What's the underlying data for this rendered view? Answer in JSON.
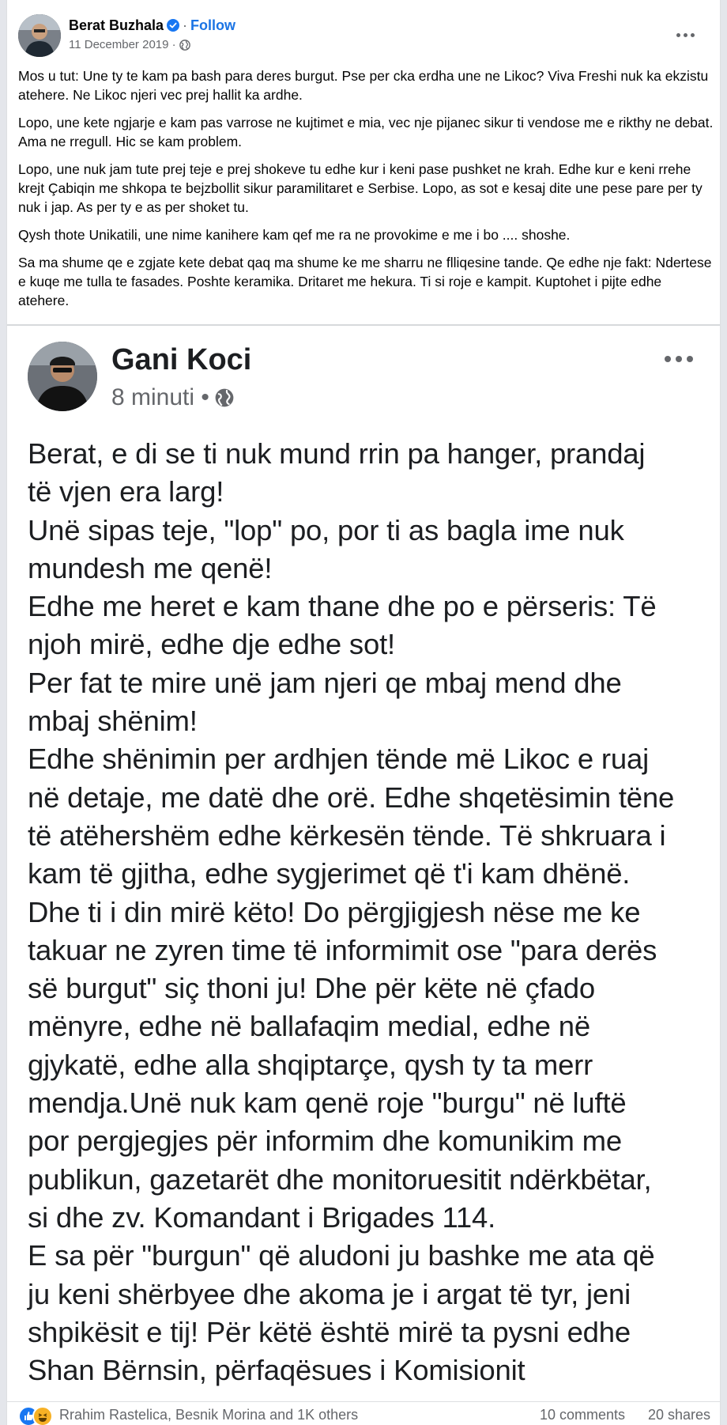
{
  "post": {
    "author": "Berat Buzhala",
    "separator": "·",
    "follow_label": "Follow",
    "date": "11 December 2019 ·",
    "paragraphs": [
      "Mos u tut: Une ty te kam pa bash para deres burgut. Pse per cka erdha une ne Likoc? Viva Freshi nuk ka ekzistu atehere. Ne Likoc njeri vec prej hallit ka ardhe.",
      "Lopo, une kete ngjarje e kam pas varrose ne kujtimet e mia, vec nje pijanec sikur ti vendose me e rikthy ne debat. Ama ne rregull. Hic se kam problem.",
      "Lopo, une nuk jam tute prej teje e prej shokeve tu edhe kur i keni pase pushket ne krah. Edhe kur e keni rrehe krejt Çabiqin me shkopa te bejzbollit sikur paramilitaret e Serbise. Lopo, as sot e kesaj dite une pese pare per ty nuk i jap. As per ty e as per shoket tu.",
      "Qysh thote Unikatili, une nime kanihere kam qef me ra ne provokime e me i bo .... shoshe.",
      "Sa ma shume qe e zgjate kete debat qaq ma shume ke me sharru ne flliqesine tande. Qe edhe nje fakt: Ndertese e kuqe me tulla te fasades. Poshte keramika. Dritaret me hekura. Ti si roje e kampit. Kuptohet i pijte edhe atehere."
    ]
  },
  "shared": {
    "author": "Gani Koci",
    "time": "8 minuti •",
    "body": "Berat, e di se ti nuk mund rrin pa hanger, prandaj\ntë vjen era larg!\nUnë sipas teje, \"lop\" po, por ti as bagla ime nuk\nmundesh me qenë!\nEdhe me heret e kam thane dhe po e përseris: Të\nnjoh mirë, edhe dje edhe sot!\nPer fat te mire unë jam njeri qe mbaj mend dhe\nmbaj shënim!\nEdhe shënimin per ardhjen tënde më Likoc e ruaj\nnë detaje, me datë dhe orë. Edhe shqetësimin tëne\ntë atëhershëm edhe kërkesën tënde. Të shkruara i\nkam të gjitha, edhe sygjerimet që t'i kam dhënë.\nDhe ti i din mirë këto! Do përgjigjesh nëse me ke\ntakuar ne zyren time të informimit ose \"para derës\nsë burgut\" siç thoni ju! Dhe për këte në çfado\nmënyre, edhe në ballafaqim medial, edhe në\ngjykatë, edhe alla shqiptarçe, qysh ty ta merr\nmendja.Unë nuk kam qenë roje \"burgu\" në luftë\npor pergjegjes për informim dhe komunikim me\npublikun, gazetarët dhe monitoruesitit ndërkbëtar,\nsi dhe zv. Komandant i Brigades 114.\nE sa për \"burgun\" që aludoni ju bashke me ata që\nju keni shërbyee dhe akoma je i argat të tyr, jeni\nshpikësit e tij! Për këtë është mirë ta pysni edhe\nShan Bërnsin, përfaqësues i Komisionit"
  },
  "footer": {
    "reactors": "Rrahim Rastelica, Besnik Morina and 1K others",
    "comments": "10 comments",
    "shares": "20 shares"
  },
  "icons": {
    "verified": "verified-badge-icon",
    "globe": "globe-icon",
    "more": "more-options-icon",
    "like": "like-reaction-icon",
    "haha": "haha-reaction-icon"
  },
  "colors": {
    "link_blue": "#1b74e4",
    "verified_blue": "#1877f2",
    "secondary_text": "#65676b"
  }
}
